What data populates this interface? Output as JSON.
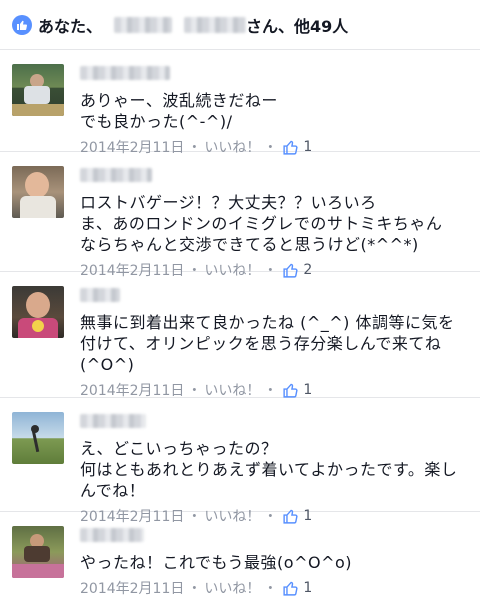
{
  "likes_bar": {
    "prefix": "あなた、",
    "suffix": "さん、他49人"
  },
  "comments": [
    {
      "text": "ありゃー、波乱続きだねー\nでも良かった(^-^)/",
      "date": "2014年2月11日",
      "like_label": "いいね！",
      "like_count": "1"
    },
    {
      "text": "ロストバゲージ！？大丈夫？？いろいろ\nま、あのロンドンのイミグレでのサトミキちゃん\nならちゃんと交渉できてると思うけど(*^^*)",
      "date": "2014年2月11日",
      "like_label": "いいね！",
      "like_count": "2"
    },
    {
      "text": "無事に到着出来て良かったね (^_^) 体調等に気を付けて、オリンピックを思う存分楽しんで来てね(^O^)",
      "date": "2014年2月11日",
      "like_label": "いいね！",
      "like_count": "1"
    },
    {
      "text": "え、どこいっちゃったの？\n何はともあれとりあえず着いてよかったです。楽しんでね！",
      "date": "2014年2月11日",
      "like_label": "いいね！",
      "like_count": "1"
    },
    {
      "text": "やったね！これでもう最強(o^O^o)",
      "date": "2014年2月11日",
      "like_label": "いいね！",
      "like_count": "1"
    }
  ],
  "separator": "・",
  "colors": {
    "accent": "#5890ff",
    "meta_text": "#9197a3",
    "divider": "#e5e6e9"
  },
  "icons": {
    "likes_badge": "thumbs-up-icon",
    "comment_like": "thumbs-up-outline-icon"
  }
}
